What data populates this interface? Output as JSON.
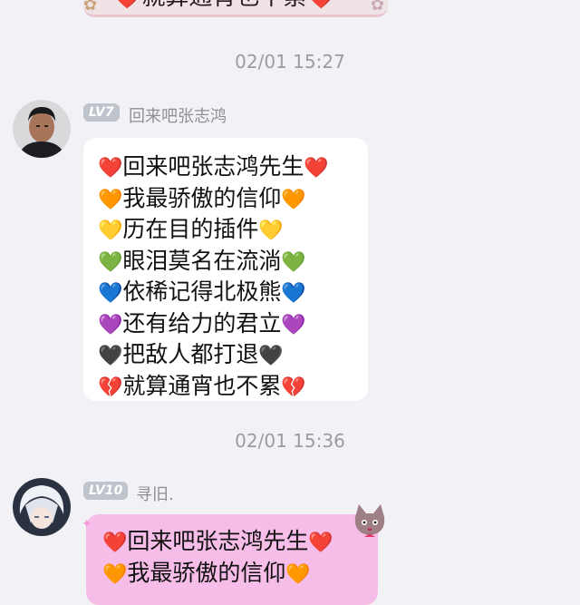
{
  "top_message": {
    "text": "❤️就算通宵也不累❤️"
  },
  "timestamps": [
    "02/01 15:27",
    "02/01 15:36"
  ],
  "messages": [
    {
      "level": "LV7",
      "sender": "回来吧张志鸿",
      "lines": [
        {
          "icon": "red-heart",
          "h": "❤️",
          "text": "回来吧张志鸿先生"
        },
        {
          "icon": "orange-heart",
          "h": "🧡",
          "text": "我最骄傲的信仰"
        },
        {
          "icon": "yellow-heart",
          "h": "💛",
          "text": "历在目的插件"
        },
        {
          "icon": "green-heart",
          "h": "💚",
          "text": "眼泪莫名在流淌"
        },
        {
          "icon": "blue-heart",
          "h": "💙",
          "text": "依稀记得北极熊"
        },
        {
          "icon": "purple-heart",
          "h": "💜",
          "text": "还有给力的君立"
        },
        {
          "icon": "black-heart",
          "h": "🖤",
          "text": "把敌人都打退"
        },
        {
          "icon": "broken-heart",
          "h": "💔",
          "text": "就算通宵也不累"
        }
      ]
    },
    {
      "level": "LV10",
      "sender": "寻旧.",
      "lines": [
        {
          "icon": "red-heart",
          "h": "❤️",
          "text": "回来吧张志鸿先生"
        },
        {
          "icon": "orange-heart",
          "h": "🧡",
          "text": "我最骄傲的信仰"
        }
      ]
    }
  ],
  "colors": {
    "background": "#f2f2f6",
    "bubble_plain": "#ffffff",
    "bubble_pink": "#f6bde8",
    "badge": "#bfc3cc",
    "timestamp": "#9b9ba3"
  }
}
